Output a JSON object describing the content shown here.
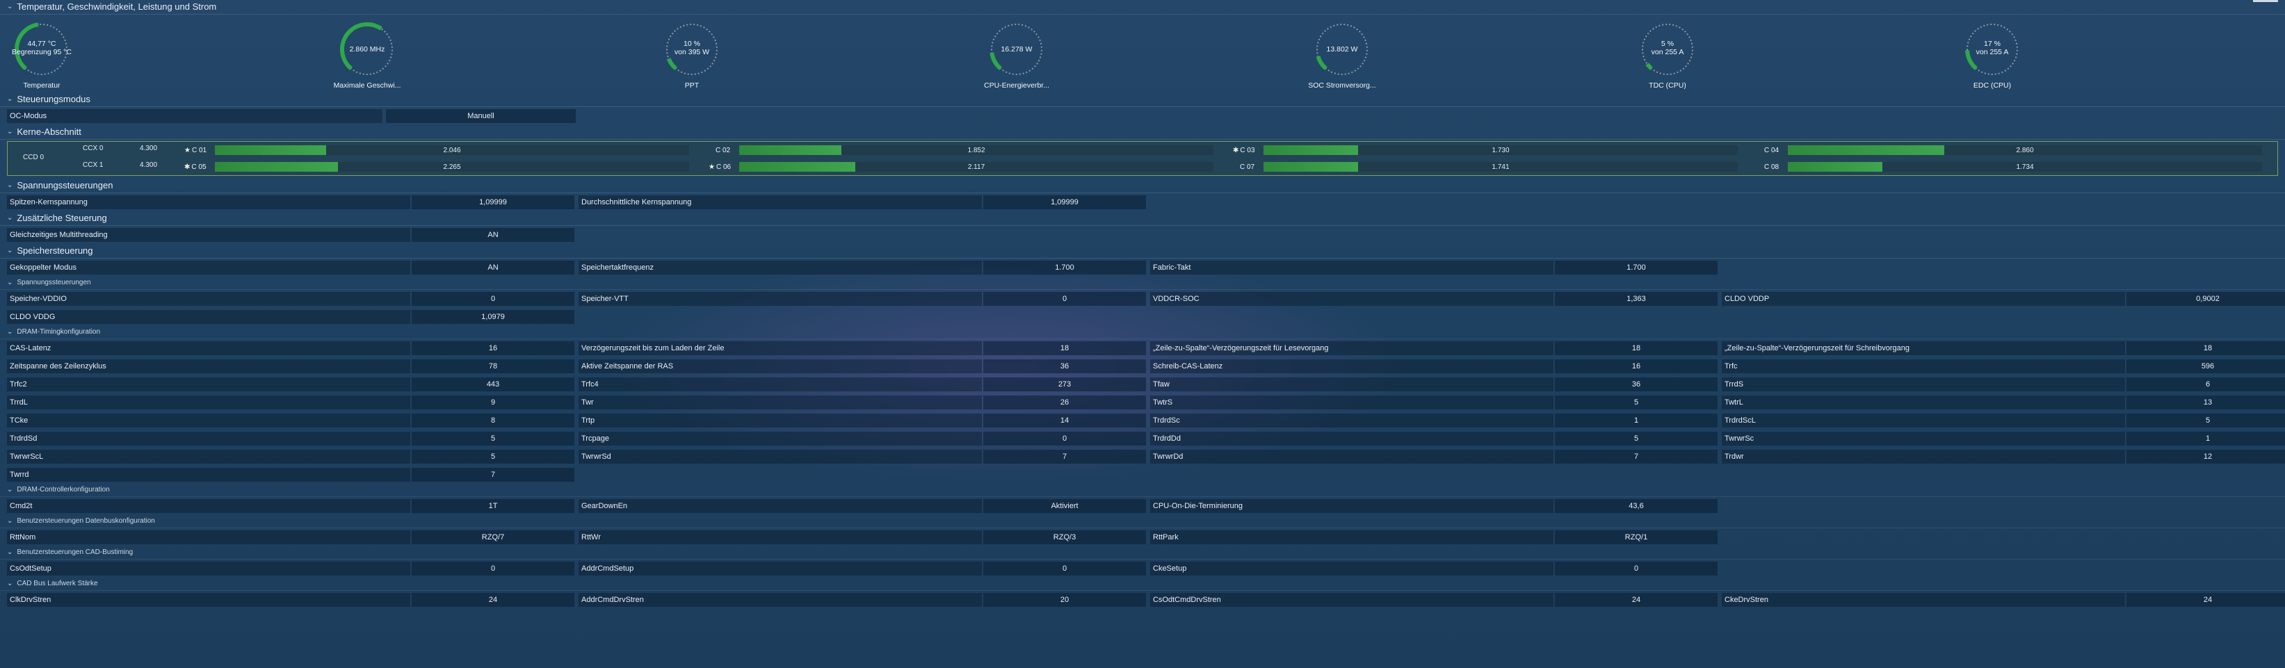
{
  "section_temp": "Temperatur, Geschwindigkeit, Leistung und Strom",
  "gauges": [
    {
      "line1": "44,77 °C",
      "line2": "Begrenzung 95 °C",
      "label": "Temperatur",
      "fraction": 0.47
    },
    {
      "line1": "2.860 MHz",
      "line2": "",
      "label": "Maximale Geschwi...",
      "fraction": 0.62
    },
    {
      "line1": "10 %",
      "line2": "von 395 W",
      "label": "PPT",
      "fraction": 0.1
    },
    {
      "line1": "16.278 W",
      "line2": "",
      "label": "CPU-Energieverbr...",
      "fraction": 0.15
    },
    {
      "line1": "13.802 W",
      "line2": "",
      "label": "SOC Stromversorg...",
      "fraction": 0.12
    },
    {
      "line1": "5 %",
      "line2": "von 255 A",
      "label": "TDC (CPU)",
      "fraction": 0.05
    },
    {
      "line1": "17 %",
      "line2": "von 255 A",
      "label": "EDC (CPU)",
      "fraction": 0.17
    }
  ],
  "section_mode": "Steuerungsmodus",
  "oc_mode": {
    "label": "OC-Modus",
    "value": "Manuell"
  },
  "section_cores": "Kerne-Abschnitt",
  "ccd": "CCD 0",
  "ccx": [
    {
      "name": "CCX 0",
      "freq": "4.300"
    },
    {
      "name": "CCX 1",
      "freq": "4.300"
    }
  ],
  "cores": [
    {
      "name": "C 01",
      "mark": "★",
      "value": "2.046",
      "fill": 0.47
    },
    {
      "name": "C 02",
      "mark": "",
      "value": "1.852",
      "fill": 0.43
    },
    {
      "name": "C 03",
      "mark": "✱",
      "value": "1.730",
      "fill": 0.4
    },
    {
      "name": "C 04",
      "mark": "",
      "value": "2.860",
      "fill": 0.66
    },
    {
      "name": "C 05",
      "mark": "✱",
      "value": "2.265",
      "fill": 0.52
    },
    {
      "name": "C 06",
      "mark": "★",
      "value": "2.117",
      "fill": 0.49
    },
    {
      "name": "C 07",
      "mark": "",
      "value": "1.741",
      "fill": 0.4
    },
    {
      "name": "C 08",
      "mark": "",
      "value": "1.734",
      "fill": 0.4
    }
  ],
  "section_voltage": "Spannungssteuerungen",
  "voltage": [
    {
      "label": "Spitzen-Kernspannung",
      "value": "1,09999"
    },
    {
      "label": "Durchschnittliche Kernspannung",
      "value": "1,09999"
    }
  ],
  "section_extra": "Zusätzliche Steuerung",
  "smt": {
    "label": "Gleichzeitiges Multithreading",
    "value": "AN"
  },
  "section_mem": "Speichersteuerung",
  "mem_top": [
    {
      "label": "Gekoppelter Modus",
      "value": "AN"
    },
    {
      "label": "Speichertaktfrequenz",
      "value": "1.700"
    },
    {
      "label": "Fabric-Takt",
      "value": "1.700"
    }
  ],
  "sub_mem_voltage": "Spannungssteuerungen",
  "mem_voltage": [
    [
      {
        "label": "Speicher-VDDIO",
        "value": "0"
      },
      {
        "label": "Speicher-VTT",
        "value": "0"
      },
      {
        "label": "VDDCR-SOC",
        "value": "1,363"
      },
      {
        "label": "CLDO VDDP",
        "value": "0,9002"
      }
    ],
    [
      {
        "label": "CLDO VDDG",
        "value": "1,0979"
      }
    ]
  ],
  "sub_dram_timing": "DRAM-Timingkonfiguration",
  "dram_timing": [
    [
      {
        "label": "CAS-Latenz",
        "value": "16"
      },
      {
        "label": "Verzögerungszeit bis zum Laden der Zeile",
        "value": "18"
      },
      {
        "label": "„Zeile-zu-Spalte“-Verzögerungszeit für Lesevorgang",
        "value": "18"
      },
      {
        "label": "„Zeile-zu-Spalte“-Verzögerungszeit für Schreibvorgang",
        "value": "18"
      }
    ],
    [
      {
        "label": "Zeitspanne des Zeilenzyklus",
        "value": "78"
      },
      {
        "label": "Aktive Zeitspanne der RAS",
        "value": "36"
      },
      {
        "label": "Schreib-CAS-Latenz",
        "value": "16"
      },
      {
        "label": "Trfc",
        "value": "596"
      }
    ],
    [
      {
        "label": "Trfc2",
        "value": "443"
      },
      {
        "label": "Trfc4",
        "value": "273"
      },
      {
        "label": "Tfaw",
        "value": "36"
      },
      {
        "label": "TrrdS",
        "value": "6"
      }
    ],
    [
      {
        "label": "TrrdL",
        "value": "9"
      },
      {
        "label": "Twr",
        "value": "26"
      },
      {
        "label": "TwtrS",
        "value": "5"
      },
      {
        "label": "TwtrL",
        "value": "13"
      }
    ],
    [
      {
        "label": "TCke",
        "value": "8"
      },
      {
        "label": "Trtp",
        "value": "14"
      },
      {
        "label": "TrdrdSc",
        "value": "1"
      },
      {
        "label": "TrdrdScL",
        "value": "5"
      }
    ],
    [
      {
        "label": "TrdrdSd",
        "value": "5"
      },
      {
        "label": "Trcpage",
        "value": "0"
      },
      {
        "label": "TrdrdDd",
        "value": "5"
      },
      {
        "label": "TwrwrSc",
        "value": "1"
      }
    ],
    [
      {
        "label": "TwrwrScL",
        "value": "5"
      },
      {
        "label": "TwrwrSd",
        "value": "7"
      },
      {
        "label": "TwrwrDd",
        "value": "7"
      },
      {
        "label": "Trdwr",
        "value": "12"
      }
    ],
    [
      {
        "label": "Twrrd",
        "value": "7"
      }
    ]
  ],
  "sub_dram_ctrl": "DRAM-Controllerkonfiguration",
  "dram_ctrl": [
    {
      "label": "Cmd2t",
      "value": "1T"
    },
    {
      "label": "GearDownEn",
      "value": "Aktiviert"
    },
    {
      "label": "CPU-On-Die-Terminierung",
      "value": "43,6"
    }
  ],
  "sub_databus": "Benutzersteuerungen Datenbuskonfiguration",
  "databus": [
    {
      "label": "RttNom",
      "value": "RZQ/7"
    },
    {
      "label": "RttWr",
      "value": "RZQ/3"
    },
    {
      "label": "RttPark",
      "value": "RZQ/1"
    }
  ],
  "sub_cad": "Benutzersteuerungen CAD-Bustiming",
  "cad": [
    {
      "label": "CsOdtSetup",
      "value": "0"
    },
    {
      "label": "AddrCmdSetup",
      "value": "0"
    },
    {
      "label": "CkeSetup",
      "value": "0"
    }
  ],
  "sub_cadbus": "CAD Bus Laufwerk Stärke",
  "cadbus": [
    {
      "label": "ClkDrvStren",
      "value": "24"
    },
    {
      "label": "AddrCmdDrvStren",
      "value": "20"
    },
    {
      "label": "CsOdtCmdDrvStren",
      "value": "24"
    },
    {
      "label": "CkeDrvStren",
      "value": "24"
    }
  ],
  "colors": {
    "gauge_arc": "#2ea84a",
    "gauge_track": "#8d98a3",
    "bar": "#3fa54f"
  }
}
